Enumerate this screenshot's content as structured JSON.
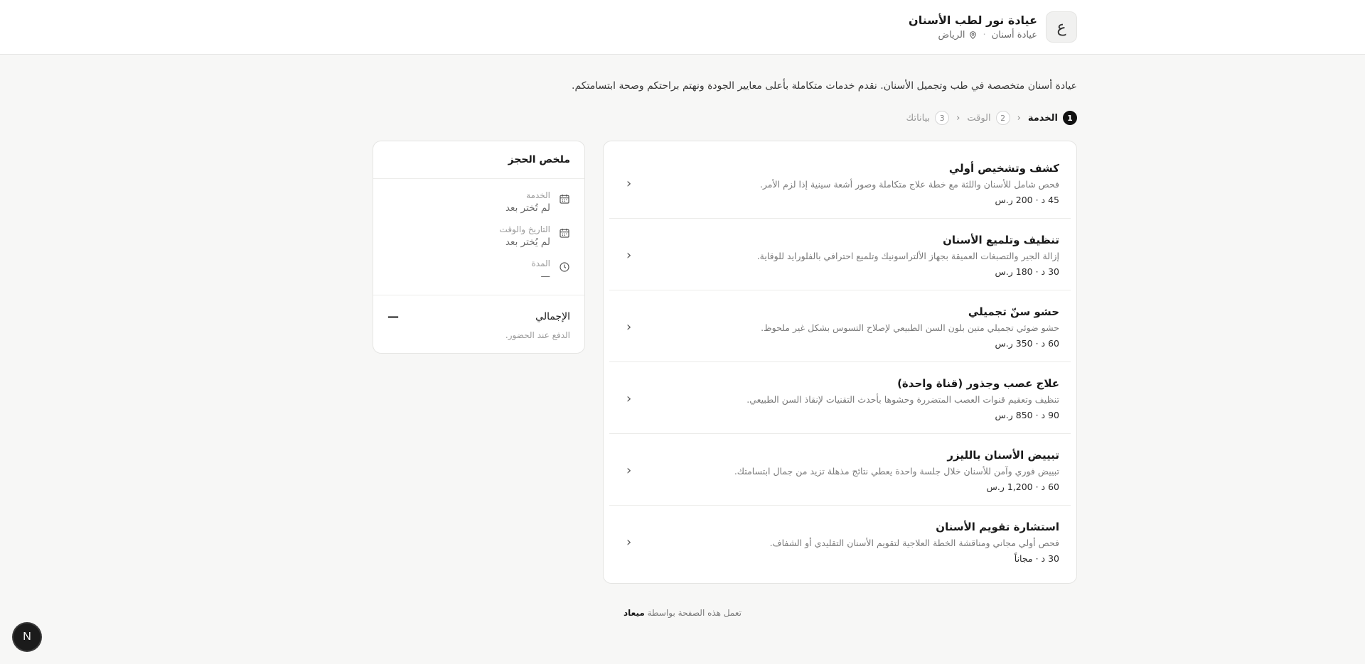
{
  "clinic": {
    "logo_letter": "ع",
    "name": "عيادة نور لطب الأسنان",
    "category": "عيادة أسنان",
    "city": "الرياض",
    "description": "عيادة أسنان متخصصة في طب وتجميل الأسنان. نقدم خدمات متكاملة بأعلى معايير الجودة ونهتم براحتكم وصحة ابتسامتكم."
  },
  "steps": [
    {
      "num": "1",
      "label": "الخدمة"
    },
    {
      "num": "2",
      "label": "الوقت"
    },
    {
      "num": "3",
      "label": "بياناتك"
    }
  ],
  "services": [
    {
      "title": "كشف وتشخيص أولي",
      "desc": "فحص شامل للأسنان واللثة مع خطة علاج متكاملة وصور أشعة سينية إذا لزم الأمر.",
      "meta": "45 د · 200 ر.س"
    },
    {
      "title": "تنظيف وتلميع الأسنان",
      "desc": "إزالة الجير والتصبغات العميقة بجهاز الألتراسونيك وتلميع احترافي بالفلورايد للوقاية.",
      "meta": "30 د · 180 ر.س"
    },
    {
      "title": "حشو سنّ تجميلي",
      "desc": "حشو ضوئي تجميلي متين بلون السن الطبيعي لإصلاح التسوس بشكل غير ملحوظ.",
      "meta": "60 د · 350 ر.س"
    },
    {
      "title": "علاج عصب وجذور (قناة واحدة)",
      "desc": "تنظيف وتعقيم قنوات العصب المتضررة وحشوها بأحدث التقنيات لإنقاذ السن الطبيعي.",
      "meta": "90 د · 850 ر.س"
    },
    {
      "title": "تبييض الأسنان بالليزر",
      "desc": "تبييض فوري وآمن للأسنان خلال جلسة واحدة يعطي نتائج مذهلة تزيد من جمال ابتسامتك.",
      "meta": "60 د · 1,200 ر.س"
    },
    {
      "title": "استشارة تقويم الأسنان",
      "desc": "فحص أولي مجاني ومناقشة الخطة العلاجية لتقويم الأسنان التقليدي أو الشفاف.",
      "meta": "30 د · مجاناً"
    }
  ],
  "summary": {
    "title": "ملخص الحجز",
    "service_label": "الخدمة",
    "service_value": "لم تُختر بعد",
    "datetime_label": "التاريخ والوقت",
    "datetime_value": "لم يُختر بعد",
    "duration_label": "المدة",
    "duration_value": "—",
    "total_label": "الإجمالي",
    "total_value": "—",
    "pay_note": "الدفع عند الحضور."
  },
  "footer": {
    "text": "تعمل هذه الصفحة بواسطة",
    "brand": "ميعاد"
  },
  "badge_letter": "N",
  "icons": [
    "location-pin-icon",
    "chevron-left-icon",
    "calendar-icon",
    "clock-icon"
  ]
}
